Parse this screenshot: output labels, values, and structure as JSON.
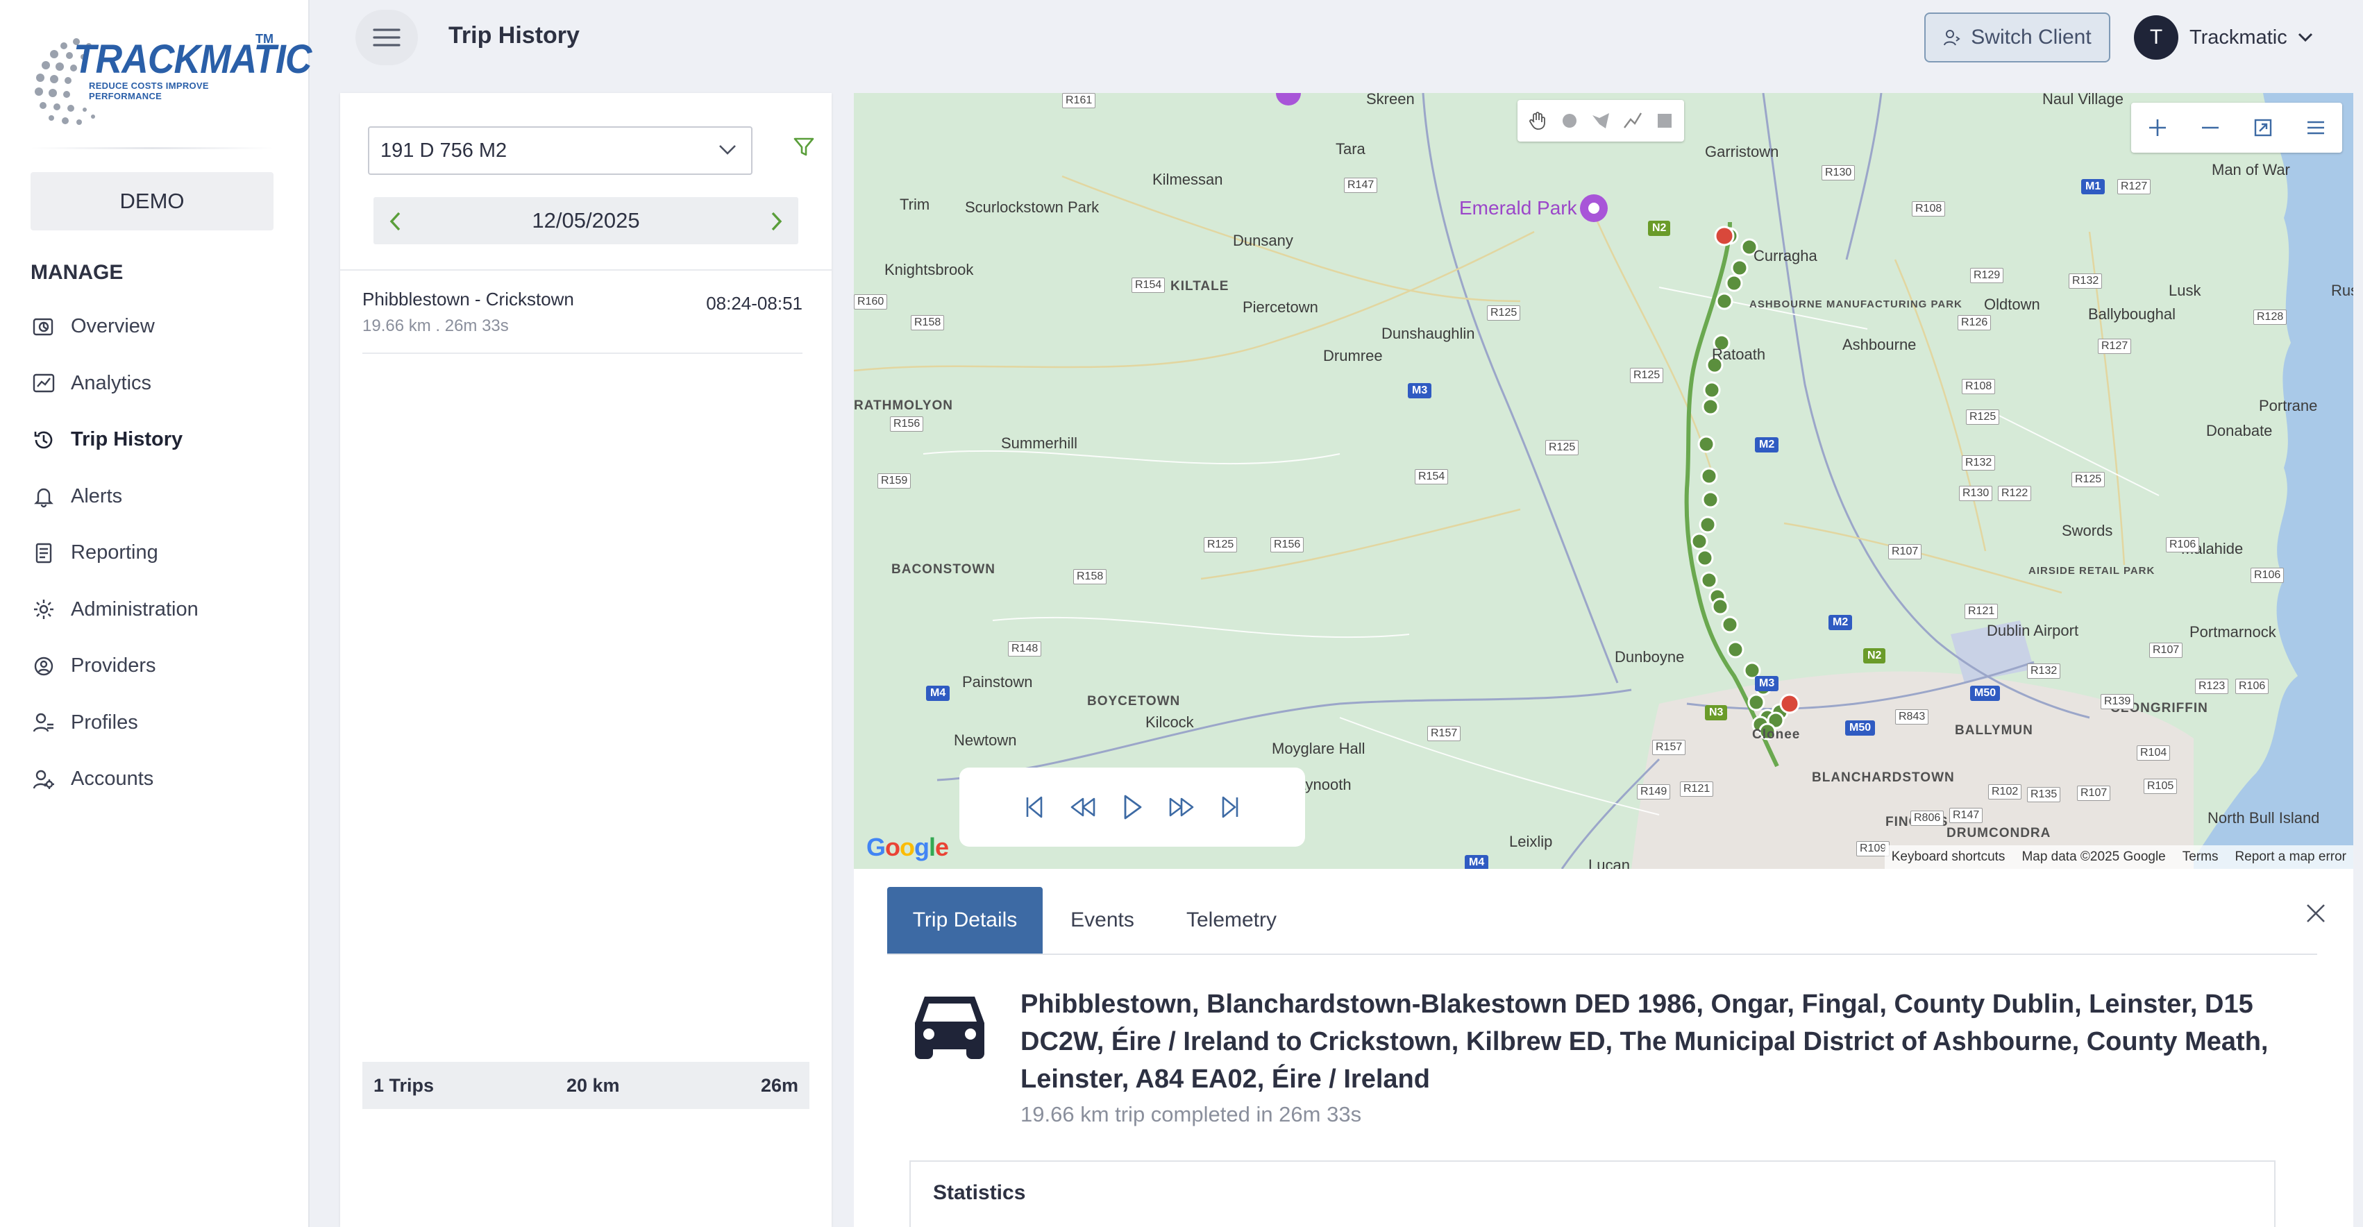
{
  "brand": {
    "logo_word": "TRACKMATIC",
    "logo_tm": "TM",
    "logo_tagline": "REDUCE COSTS IMPROVE PERFORMANCE"
  },
  "sidebar": {
    "client_label": "DEMO",
    "section_heading": "MANAGE",
    "items": [
      {
        "label": "Overview",
        "icon": "overview-icon"
      },
      {
        "label": "Analytics",
        "icon": "analytics-icon"
      },
      {
        "label": "Trip History",
        "icon": "history-icon",
        "active": true
      },
      {
        "label": "Alerts",
        "icon": "bell-icon"
      },
      {
        "label": "Reporting",
        "icon": "report-icon"
      },
      {
        "label": "Administration",
        "icon": "gear-icon"
      },
      {
        "label": "Providers",
        "icon": "provider-icon"
      },
      {
        "label": "Profiles",
        "icon": "profile-icon"
      },
      {
        "label": "Accounts",
        "icon": "accounts-icon"
      }
    ]
  },
  "header": {
    "title": "Trip History",
    "switch_client_label": "Switch Client",
    "user_initial": "T",
    "user_name": "Trackmatic"
  },
  "trip_panel": {
    "vehicle": "191 D 756 M2",
    "date": "12/05/2025",
    "trips": [
      {
        "route": "Phibblestown - Crickstown",
        "meta": "19.66 km . 26m 33s",
        "time": "08:24-08:51"
      }
    ],
    "totals": {
      "trips": "1 Trips",
      "distance": "20 km",
      "duration": "26m"
    }
  },
  "map": {
    "poi": "Emerald Park",
    "places": [
      "Skreen",
      "Tara",
      "Kilmessan",
      "Garristown",
      "Naul Village",
      "Man of War",
      "Trim",
      "Scurlockstown Park",
      "Dunsany",
      "Knightsbrook",
      "KILTALE",
      "Piercetown",
      "Dunshaughlin",
      "Drumree",
      "Ratoath",
      "Ashbourne",
      "Oldtown",
      "Ballyboughal",
      "Lusk",
      "Rush",
      "Donabate",
      "Portrane",
      "Summerhill",
      "RATHMOLYON",
      "BACONSTOWN",
      "Swords",
      "AIRSIDE RETAIL PARK",
      "Malahide",
      "Dublin Airport",
      "Portmarnock",
      "Dunboyne",
      "Painstown",
      "BOYCETOWN",
      "Kilcock",
      "Newtown",
      "Moyglare Hall",
      "Maynooth",
      "Leixlip",
      "Lucan",
      "BLANCHARDSTOWN",
      "FINGLAS",
      "BALLYMUN",
      "CLONGRIFFIN",
      "DRUMCONDRA",
      "North Bull Island",
      "Clonee",
      "ASHBOURNE MANUFACTURING PARK",
      "Curragha"
    ],
    "google": "Google",
    "attribution": [
      "Keyboard shortcuts",
      "Map data ©2025 Google",
      "Terms",
      "Report a map error"
    ]
  },
  "details": {
    "tabs": [
      "Trip Details",
      "Events",
      "Telemetry"
    ],
    "route_title": "Phibblestown, Blanchardstown-Blakestown DED 1986, Ongar, Fingal, County Dublin, Leinster, D15 DC2W, Éire / Ireland to Crickstown, Kilbrew ED, The Municipal District of Ashbourne, County Meath, Leinster, A84 EA02, Éire / Ireland",
    "summary": "19.66 km trip completed in 26m 33s",
    "statistics_heading": "Statistics"
  },
  "colors": {
    "accent": "#3d6aa4",
    "brand_blue": "#2a5fa8",
    "route_green": "#6aa84f",
    "map_land": "#d6ead7"
  }
}
